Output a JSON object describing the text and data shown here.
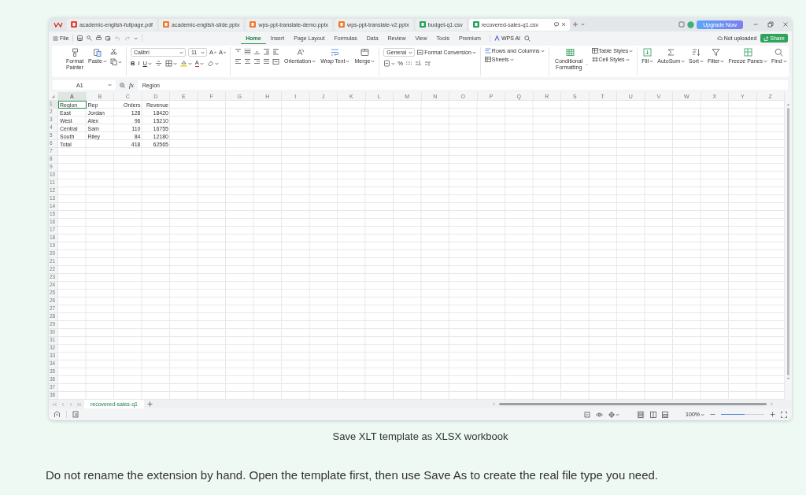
{
  "app_tabs": [
    {
      "label": "academic-english-fullpage.pdf",
      "color": "#e0463a",
      "selected": false
    },
    {
      "label": "academic-english-slide.pptx",
      "color": "#ef7b2c",
      "selected": false
    },
    {
      "label": "wps-ppt-translate-demo.pptx",
      "color": "#ef7b2c",
      "selected": false
    },
    {
      "label": "wps-ppt-translate-v2.pptx",
      "color": "#ef7b2c",
      "selected": false
    },
    {
      "label": "budget-q1.csv",
      "color": "#25a35a",
      "selected": false
    },
    {
      "label": "recovered-sales-q1.csv",
      "color": "#25a35a",
      "selected": true
    }
  ],
  "title_bar": {
    "upgrade_button": "Upgrade Now"
  },
  "menu": {
    "file": "File",
    "tabs": [
      {
        "label": "Home",
        "selected": true
      },
      {
        "label": "Insert",
        "selected": false
      },
      {
        "label": "Page Layout",
        "selected": false
      },
      {
        "label": "Formulas",
        "selected": false
      },
      {
        "label": "Data",
        "selected": false
      },
      {
        "label": "Review",
        "selected": false
      },
      {
        "label": "View",
        "selected": false
      },
      {
        "label": "Tools",
        "selected": false
      },
      {
        "label": "Premium",
        "selected": false
      }
    ],
    "wps_ai": "WPS AI",
    "upload_status": "Not uploaded",
    "share": "Share"
  },
  "ribbon": {
    "format_painter": "Format Painter",
    "paste": "Paste",
    "font_name": "Calibri",
    "font_size": "11",
    "grow_font": "A",
    "shrink_font": "A",
    "font_styles": [
      {
        "label": "B",
        "kind": "bold"
      },
      {
        "label": "I",
        "kind": "italic"
      },
      {
        "label": "U",
        "kind": "underline"
      }
    ],
    "font_color": "A",
    "orientation": "Orientation",
    "wrap_text": "Wrap Text",
    "merge": "Merge",
    "number_format": "General",
    "format_conversion": "Format Conversion",
    "percent": "%",
    "rows_and_columns": "Rows and Columns",
    "sheets": "Sheets",
    "conditional_formatting": "Conditional Formatting",
    "table_styles": "Table Styles",
    "cell_styles": "Cell Styles",
    "editing": [
      {
        "label": "Fill",
        "kind": "fill"
      },
      {
        "label": "AutoSum",
        "kind": "sum"
      },
      {
        "label": "Sort",
        "kind": "sort"
      },
      {
        "label": "Filter",
        "kind": "filter"
      },
      {
        "label": "Freeze Panes",
        "kind": "freeze"
      },
      {
        "label": "Find",
        "kind": "find"
      }
    ]
  },
  "formula_bar": {
    "cell_ref": "A1",
    "fx": "fx",
    "value": "Region"
  },
  "sheet": {
    "columns": [
      {
        "label": "A",
        "kind": "text",
        "selected": true
      },
      {
        "label": "B",
        "kind": "text",
        "selected": false
      },
      {
        "label": "C",
        "kind": "number",
        "selected": false
      },
      {
        "label": "D",
        "kind": "number",
        "selected": false
      },
      {
        "label": "E",
        "selected": false
      },
      {
        "label": "F",
        "selected": false
      },
      {
        "label": "G",
        "selected": false
      },
      {
        "label": "H",
        "selected": false
      },
      {
        "label": "I",
        "selected": false
      },
      {
        "label": "J",
        "selected": false
      },
      {
        "label": "K",
        "selected": false
      },
      {
        "label": "L",
        "selected": false
      },
      {
        "label": "M",
        "selected": false
      },
      {
        "label": "N",
        "selected": false
      },
      {
        "label": "O",
        "selected": false
      },
      {
        "label": "P",
        "selected": false
      },
      {
        "label": "Q",
        "selected": false
      },
      {
        "label": "R",
        "selected": false
      },
      {
        "label": "S",
        "selected": false
      },
      {
        "label": "T",
        "selected": false
      },
      {
        "label": "U",
        "selected": false
      },
      {
        "label": "V",
        "selected": false
      },
      {
        "label": "W",
        "selected": false
      },
      {
        "label": "X",
        "selected": false
      },
      {
        "label": "Y",
        "selected": false
      },
      {
        "label": "Z",
        "selected": false
      }
    ],
    "rows": [
      {
        "number": "1",
        "selected": true,
        "cells": [
          "Region",
          "Rep",
          "Orders",
          "Revenue"
        ]
      },
      {
        "number": "2",
        "selected": false,
        "cells": [
          "East",
          "Jordan",
          "128",
          "18420"
        ]
      },
      {
        "number": "3",
        "selected": false,
        "cells": [
          "West",
          "Alex",
          "96",
          "15210"
        ]
      },
      {
        "number": "4",
        "selected": false,
        "cells": [
          "Central",
          "Sam",
          "110",
          "16755"
        ]
      },
      {
        "number": "5",
        "selected": false,
        "cells": [
          "South",
          "Riley",
          "84",
          "12180"
        ]
      },
      {
        "number": "6",
        "selected": false,
        "cells": [
          "Total",
          null,
          "418",
          "62565"
        ]
      },
      {
        "number": "7",
        "selected": false
      },
      {
        "number": "8",
        "selected": false
      },
      {
        "number": "9",
        "selected": false
      },
      {
        "number": "10",
        "selected": false
      },
      {
        "number": "11",
        "selected": false
      },
      {
        "number": "12",
        "selected": false
      },
      {
        "number": "13",
        "selected": false
      },
      {
        "number": "14",
        "selected": false
      },
      {
        "number": "15",
        "selected": false
      },
      {
        "number": "16",
        "selected": false
      },
      {
        "number": "17",
        "selected": false
      },
      {
        "number": "18",
        "selected": false
      },
      {
        "number": "19",
        "selected": false
      },
      {
        "number": "20",
        "selected": false
      },
      {
        "number": "21",
        "selected": false
      },
      {
        "number": "22",
        "selected": false
      },
      {
        "number": "23",
        "selected": false
      },
      {
        "number": "24",
        "selected": false
      },
      {
        "number": "25",
        "selected": false
      },
      {
        "number": "26",
        "selected": false
      },
      {
        "number": "27",
        "selected": false
      },
      {
        "number": "28",
        "selected": false
      },
      {
        "number": "29",
        "selected": false
      },
      {
        "number": "30",
        "selected": false
      },
      {
        "number": "31",
        "selected": false
      },
      {
        "number": "32",
        "selected": false
      },
      {
        "number": "33",
        "selected": false
      },
      {
        "number": "34",
        "selected": false
      },
      {
        "number": "35",
        "selected": false
      },
      {
        "number": "36",
        "selected": false
      },
      {
        "number": "37",
        "selected": false
      },
      {
        "number": "38",
        "selected": false
      }
    ]
  },
  "sheet_tabs": [
    {
      "label": "recovered-sales-q1",
      "selected": true
    }
  ],
  "status_bar": {
    "zoom": "100%",
    "zoom_level": {
      "level": 0.55
    }
  },
  "caption": "Save XLT template as XLSX workbook",
  "note": "Do not rename the extension by hand. Open the template first, then use Save As to create the real file type you need."
}
